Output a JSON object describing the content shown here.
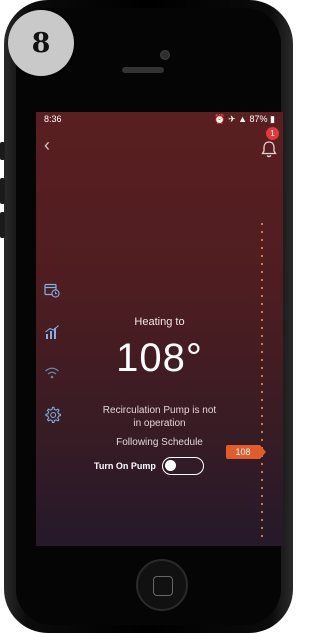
{
  "step_number": "8",
  "status_bar": {
    "time": "8:36",
    "battery": "87%"
  },
  "notifications": {
    "count": "1"
  },
  "heating": {
    "label": "Heating to",
    "temperature": "108°",
    "pump_status": "Recirculation Pump is not in operation",
    "schedule_status": "Following Schedule",
    "setpoint_marker": "108"
  },
  "pump_toggle": {
    "label": "Turn On Pump",
    "on": false
  },
  "icons": [
    "back-arrow-icon",
    "bell-icon",
    "calendar-clock-icon",
    "usage-chart-icon",
    "wifi-icon",
    "settings-gear-icon"
  ],
  "colors": {
    "accent": "#e05c2c",
    "badge": "#e23a3a"
  }
}
